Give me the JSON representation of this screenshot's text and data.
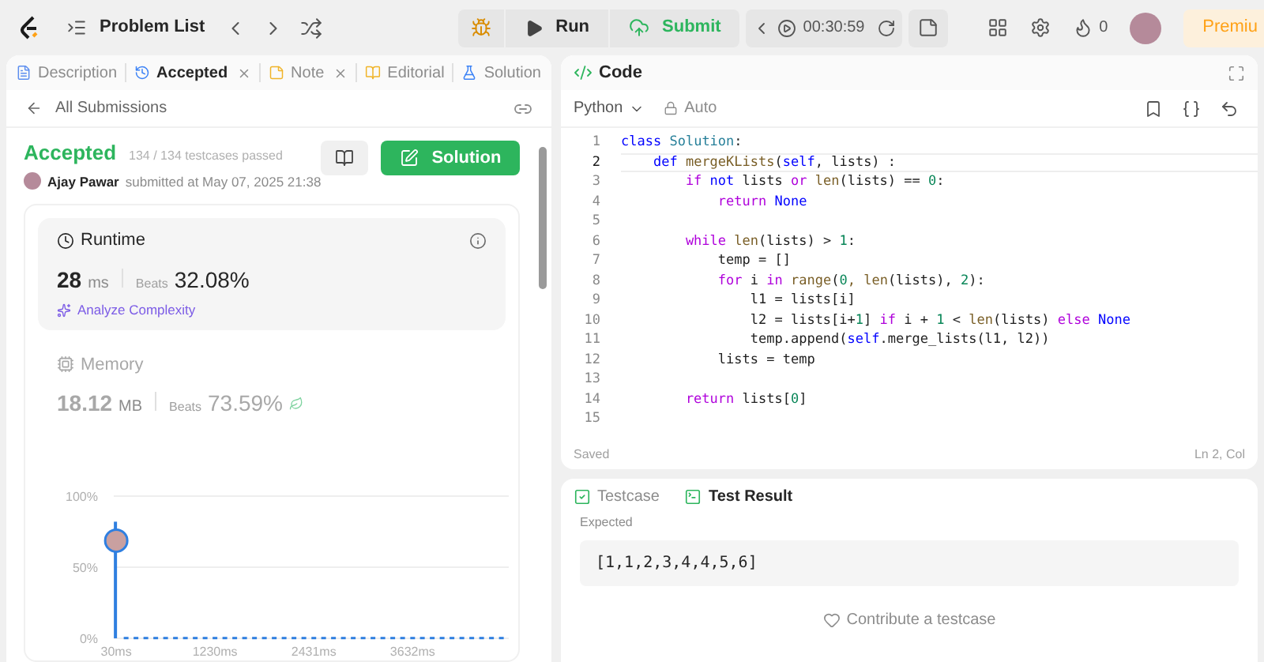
{
  "topbar": {
    "title": "Problem List",
    "run": "Run",
    "submit": "Submit",
    "timer": "00:30:59",
    "streak": "0",
    "premium": "Premiu"
  },
  "left_tabs": [
    {
      "label": "Description",
      "selected": false,
      "closable": false,
      "kind": "description"
    },
    {
      "label": "Accepted",
      "selected": true,
      "closable": true,
      "kind": "history"
    },
    {
      "label": "Note",
      "selected": false,
      "closable": true,
      "kind": "note"
    },
    {
      "label": "Editorial",
      "selected": false,
      "closable": false,
      "kind": "editorial"
    },
    {
      "label": "Solution",
      "selected": false,
      "closable": false,
      "kind": "flask"
    }
  ],
  "back_link": "All Submissions",
  "submission": {
    "status": "Accepted",
    "passed": "134 / 134 testcases passed",
    "author": "Ajay Pawar",
    "submitted": "submitted at May 07, 2025 21:38",
    "solution_button": "Solution"
  },
  "runtime": {
    "title": "Runtime",
    "value": "28",
    "unit": "ms",
    "beats_label": "Beats",
    "beats": "32.08%",
    "analyze": "Analyze Complexity",
    "selected": true
  },
  "memory": {
    "title": "Memory",
    "value": "18.12",
    "unit": "MB",
    "beats_label": "Beats",
    "beats": "73.59%",
    "selected": false
  },
  "chart_data": {
    "type": "bar",
    "x": [
      30,
      150,
      270,
      390,
      510,
      630,
      750,
      870,
      990,
      1110,
      1230,
      1350,
      1470,
      1590,
      1710,
      1830,
      1950,
      2070,
      2190,
      2310,
      2431,
      2550,
      2670,
      2790,
      2910,
      3030,
      3150,
      3270,
      3390,
      3510,
      3632,
      3750,
      3870,
      3990,
      4110,
      4230,
      4350,
      4470,
      4590,
      4710
    ],
    "series": [
      {
        "color": "#2f7fe0",
        "values": [
          82,
          1,
          1,
          1,
          1,
          1,
          1,
          1,
          1,
          1,
          1,
          1,
          1,
          1,
          1,
          1,
          1,
          1,
          1,
          1,
          1,
          1,
          1,
          1,
          1,
          1,
          1,
          1,
          1,
          1,
          1,
          1,
          1,
          1,
          1,
          1,
          1,
          1,
          1,
          1
        ]
      }
    ],
    "ylim": [
      0,
      100
    ],
    "xlim": [
      0,
      4800
    ],
    "yticks": [
      {
        "value": 0,
        "label": "0%"
      },
      {
        "value": 50,
        "label": "50%"
      },
      {
        "value": 100,
        "label": "100%"
      }
    ],
    "xticks": [
      {
        "value": 30,
        "label": "30ms"
      },
      {
        "value": 1230,
        "label": "1230ms"
      },
      {
        "value": 2431,
        "label": "2431ms"
      },
      {
        "value": 3632,
        "label": "3632ms"
      }
    ]
  },
  "code_panel": {
    "title": "Code",
    "language": "Python",
    "mode": "Auto",
    "status": "Saved",
    "cursor": "Ln 2, Col"
  },
  "code_lines": [
    {
      "number": "1",
      "selected": false,
      "tokens": [
        {
          "kind": "keyword2",
          "text": "class "
        },
        {
          "kind": "type",
          "text": "Solution"
        },
        {
          "kind": "plain",
          "text": ":"
        }
      ]
    },
    {
      "number": "2",
      "selected": true,
      "tokens": [
        {
          "kind": "keyword2",
          "text": "    def "
        },
        {
          "kind": "function",
          "text": "mergeKLists"
        },
        {
          "kind": "plain",
          "text": "("
        },
        {
          "kind": "keyword2",
          "text": "self"
        },
        {
          "kind": "plain",
          "text": ", lists) :"
        }
      ]
    },
    {
      "number": "3",
      "selected": false,
      "tokens": [
        {
          "kind": "keyword",
          "text": "        if "
        },
        {
          "kind": "keyword2",
          "text": "not"
        },
        {
          "kind": "plain",
          "text": " lists "
        },
        {
          "kind": "keyword",
          "text": "or"
        },
        {
          "kind": "function",
          "text": " len"
        },
        {
          "kind": "plain",
          "text": "(lists) == "
        },
        {
          "kind": "number",
          "text": "0"
        },
        {
          "kind": "plain",
          "text": ":"
        }
      ]
    },
    {
      "number": "4",
      "selected": false,
      "tokens": [
        {
          "kind": "keyword",
          "text": "            return "
        },
        {
          "kind": "keyword2",
          "text": "None"
        }
      ]
    },
    {
      "number": "5",
      "selected": false
    },
    {
      "number": "6",
      "selected": false,
      "tokens": [
        {
          "kind": "keyword",
          "text": "        while "
        },
        {
          "kind": "function",
          "text": "len"
        },
        {
          "kind": "plain",
          "text": "(lists) > "
        },
        {
          "kind": "number",
          "text": "1"
        },
        {
          "kind": "plain",
          "text": ":"
        }
      ]
    },
    {
      "number": "7",
      "selected": false,
      "tokens": [
        {
          "kind": "plain",
          "text": "            temp = []"
        }
      ]
    },
    {
      "number": "8",
      "selected": false,
      "tokens": [
        {
          "kind": "keyword",
          "text": "            for"
        },
        {
          "kind": "plain",
          "text": " i "
        },
        {
          "kind": "keyword",
          "text": "in"
        },
        {
          "kind": "function",
          "text": " range"
        },
        {
          "kind": "plain",
          "text": "("
        },
        {
          "kind": "number",
          "text": "0"
        },
        {
          "kind": "function",
          "text": ", len"
        },
        {
          "kind": "plain",
          "text": "(lists), "
        },
        {
          "kind": "number",
          "text": "2"
        },
        {
          "kind": "plain",
          "text": "):"
        }
      ]
    },
    {
      "number": "9",
      "selected": false,
      "tokens": [
        {
          "kind": "plain",
          "text": "                l1 = lists[i]"
        }
      ]
    },
    {
      "number": "10",
      "selected": false,
      "tokens": [
        {
          "kind": "plain",
          "text": "                l2 = lists[i+"
        },
        {
          "kind": "number",
          "text": "1"
        },
        {
          "kind": "plain",
          "text": "] "
        },
        {
          "kind": "keyword",
          "text": "if"
        },
        {
          "kind": "plain",
          "text": " i + "
        },
        {
          "kind": "number",
          "text": "1"
        },
        {
          "kind": "plain",
          "text": " < "
        },
        {
          "kind": "function",
          "text": "len"
        },
        {
          "kind": "plain",
          "text": "(lists) "
        },
        {
          "kind": "keyword",
          "text": "else "
        },
        {
          "kind": "keyword2",
          "text": "None"
        }
      ]
    },
    {
      "number": "11",
      "selected": false,
      "tokens": [
        {
          "kind": "plain",
          "text": "                temp.append("
        },
        {
          "kind": "keyword2",
          "text": "self"
        },
        {
          "kind": "plain",
          "text": ".merge_lists(l1, l2))"
        }
      ]
    },
    {
      "number": "12",
      "selected": false,
      "tokens": [
        {
          "kind": "plain",
          "text": "            lists = temp"
        }
      ]
    },
    {
      "number": "13",
      "selected": false
    },
    {
      "number": "14",
      "selected": false,
      "tokens": [
        {
          "kind": "keyword",
          "text": "        return"
        },
        {
          "kind": "plain",
          "text": " lists["
        },
        {
          "kind": "number",
          "text": "0"
        },
        {
          "kind": "plain",
          "text": "]"
        }
      ]
    },
    {
      "number": "15",
      "selected": false
    }
  ],
  "bottom_tabs": [
    {
      "label": "Testcase",
      "selected": false,
      "kind": "check"
    },
    {
      "label": "Test Result",
      "selected": true,
      "kind": "terminal"
    }
  ],
  "result": {
    "label": "Expected",
    "value": "[1,1,2,3,4,4,5,6]",
    "contribute": "Contribute a testcase"
  }
}
